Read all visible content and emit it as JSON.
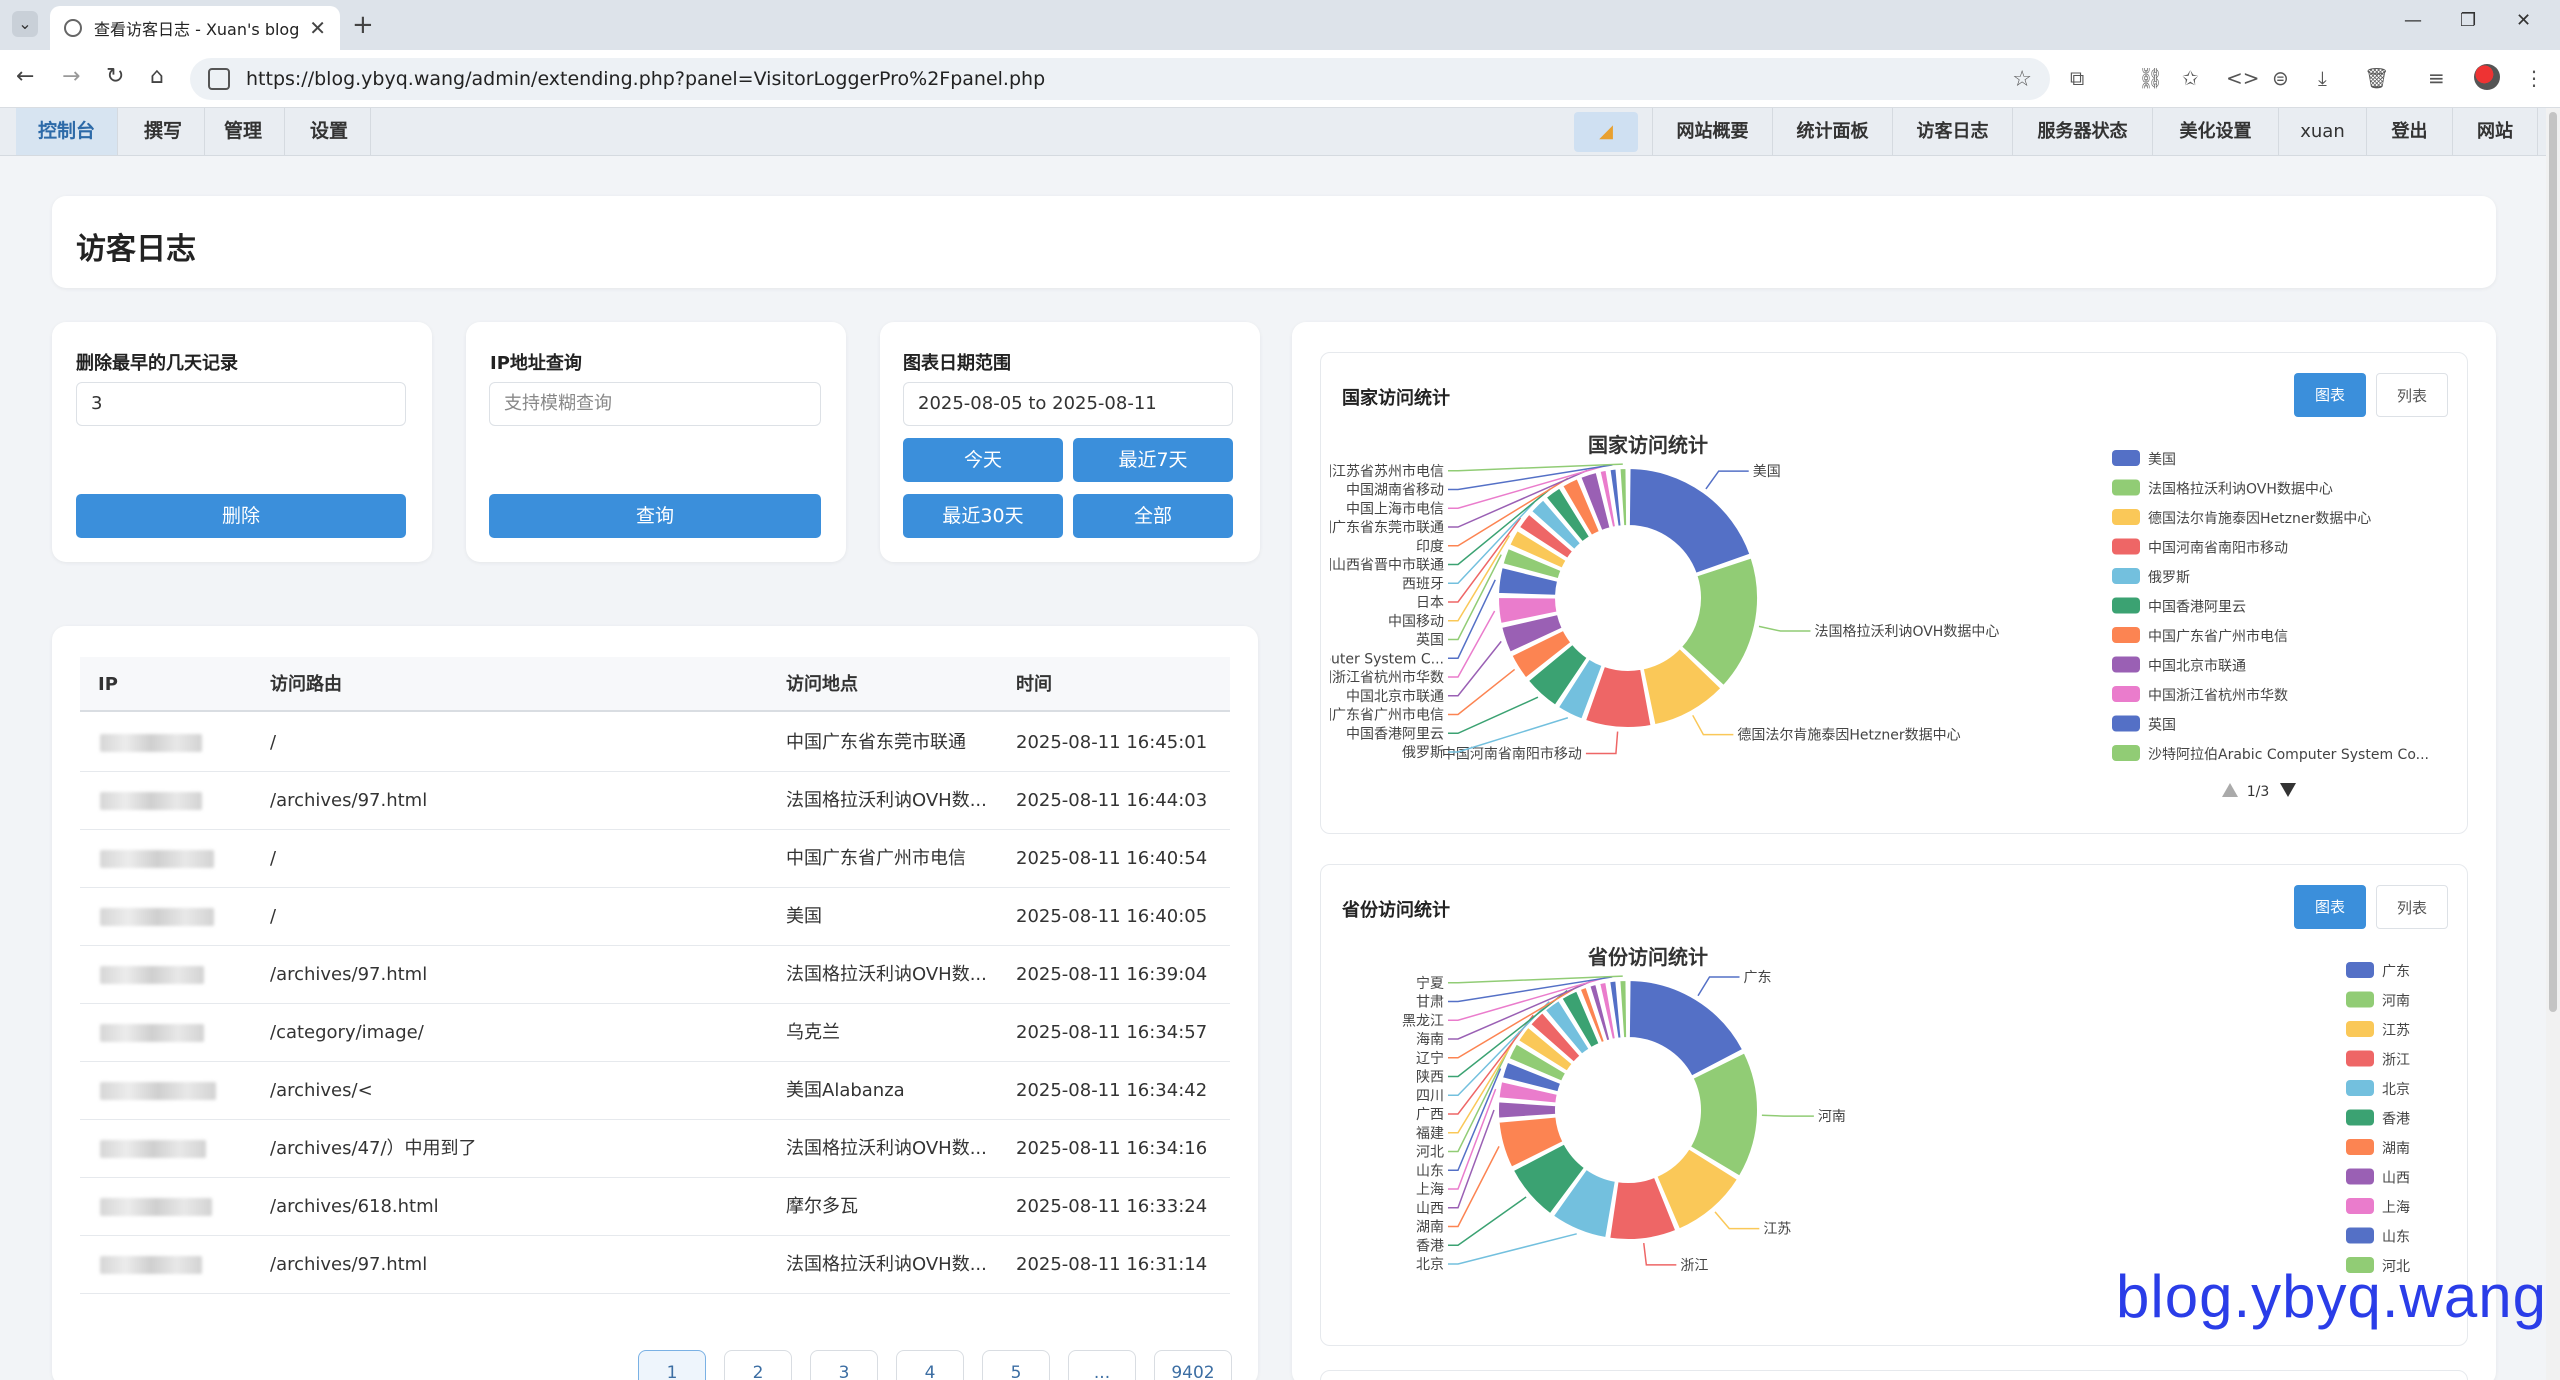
{
  "browser": {
    "tab_title": "查看访客日志 - Xuan's blog - Powered by Typecho",
    "url": "https://blog.ybyq.wang/admin/extending.php?panel=VisitorLoggerPro%2Fpanel.php"
  },
  "admin_nav": {
    "left": [
      "控制台",
      "撰写",
      "管理",
      "设置"
    ],
    "right": [
      "网站概要",
      "统计面板",
      "访客日志",
      "服务器状态",
      "美化设置",
      "xuan",
      "登出",
      "网站"
    ]
  },
  "page": {
    "title": "访客日志",
    "delete": {
      "label": "删除最早的几天记录",
      "value": "3",
      "button": "删除"
    },
    "ip_query": {
      "label": "IP地址查询",
      "placeholder": "支持模糊查询",
      "button": "查询"
    },
    "date_range": {
      "label": "图表日期范围",
      "value": "2025-08-05 to 2025-08-11",
      "buttons": [
        "今天",
        "最近7天",
        "最近30天",
        "全部"
      ]
    }
  },
  "table": {
    "headers": [
      "IP",
      "访问路由",
      "访问地点",
      "时间"
    ],
    "rows": [
      {
        "route": "/",
        "location": "中国广东省东莞市联通",
        "time": "2025-08-11 16:45:01"
      },
      {
        "route": "/archives/97.html",
        "location": "法国格拉沃利讷OVH数...",
        "time": "2025-08-11 16:44:03"
      },
      {
        "route": "/",
        "location": "中国广东省广州市电信",
        "time": "2025-08-11 16:40:54"
      },
      {
        "route": "/",
        "location": "美国",
        "time": "2025-08-11 16:40:05"
      },
      {
        "route": "/archives/97.html",
        "location": "法国格拉沃利讷OVH数...",
        "time": "2025-08-11 16:39:04"
      },
      {
        "route": "/category/image/",
        "location": "乌克兰",
        "time": "2025-08-11 16:34:57"
      },
      {
        "route": "/archives/<",
        "location": "美国Alabanza",
        "time": "2025-08-11 16:34:42"
      },
      {
        "route": "/archives/47/）中用到了",
        "location": "法国格拉沃利讷OVH数...",
        "time": "2025-08-11 16:34:16"
      },
      {
        "route": "/archives/618.html",
        "location": "摩尔多瓦",
        "time": "2025-08-11 16:33:24"
      },
      {
        "route": "/archives/97.html",
        "location": "法国格拉沃利讷OVH数...",
        "time": "2025-08-11 16:31:14"
      }
    ],
    "pagination": [
      "1",
      "2",
      "3",
      "4",
      "5",
      "...",
      "9402"
    ]
  },
  "country_panel": {
    "header": "国家访问统计",
    "toggle": [
      "图表",
      "列表"
    ],
    "legend_page": "1/3"
  },
  "province_panel": {
    "header": "省份访问统计",
    "toggle": [
      "图表",
      "列表"
    ]
  },
  "chart_data": [
    {
      "type": "pie",
      "title": "国家访问统计",
      "categories": [
        "美国",
        "法国格拉沃利讷OVH数据中心",
        "德国法尔肯施泰因Hetzner数据中心",
        "中国河南省南阳市移动",
        "俄罗斯",
        "中国香港阿里云",
        "中国广东省广州市电信",
        "中国北京市联通",
        "中国浙江省杭州市华数",
        "沙特阿拉伯Arabic Computer System C...",
        "英国",
        "中国移动",
        "日本",
        "西班牙",
        "中国山西省晋中市联通",
        "印度",
        "中国广东省东莞市联通",
        "中国上海市电信",
        "中国湖南省移动",
        "中国江苏省苏州市电信"
      ],
      "values": [
        16,
        14,
        8,
        7,
        3,
        4,
        3,
        3,
        3,
        3,
        2,
        2,
        2,
        2,
        2,
        2,
        2,
        1,
        1,
        1
      ],
      "legend_visible": [
        "美国",
        "法国格拉沃利讷OVH数据中心",
        "德国法尔肯施泰因Hetzner数据中心",
        "中国河南省南阳市移动",
        "俄罗斯",
        "中国香港阿里云",
        "中国广东省广州市电信",
        "中国北京市联通",
        "中国浙江省杭州市华数",
        "英国",
        "沙特阿拉伯Arabic Computer System Co..."
      ],
      "legend": "right"
    },
    {
      "type": "pie",
      "title": "省份访问统计",
      "categories": [
        "广东",
        "河南",
        "江苏",
        "浙江",
        "北京",
        "香港",
        "湖南",
        "山西",
        "上海",
        "山东",
        "河北",
        "福建",
        "广西",
        "四川",
        "陕西",
        "辽宁",
        "海南",
        "黑龙江",
        "甘肃",
        "宁夏"
      ],
      "values": [
        14,
        13,
        8,
        7,
        6,
        6,
        5,
        2,
        2,
        2,
        2,
        2,
        2,
        2,
        2,
        1,
        1,
        1,
        1,
        1
      ],
      "legend_visible": [
        "广东",
        "河南",
        "江苏",
        "浙江",
        "北京",
        "香港",
        "湖南",
        "山西",
        "上海",
        "山东",
        "河北",
        "福建"
      ],
      "legend": "right"
    }
  ],
  "colors": {
    "accent": "#3b8fdb",
    "palette": [
      "#5470c6",
      "#91cc75",
      "#fac858",
      "#ee6666",
      "#73c0de",
      "#3ba272",
      "#fc8452",
      "#9a60b4",
      "#ea7ccc"
    ]
  },
  "watermark": "blog.ybyq.wang"
}
